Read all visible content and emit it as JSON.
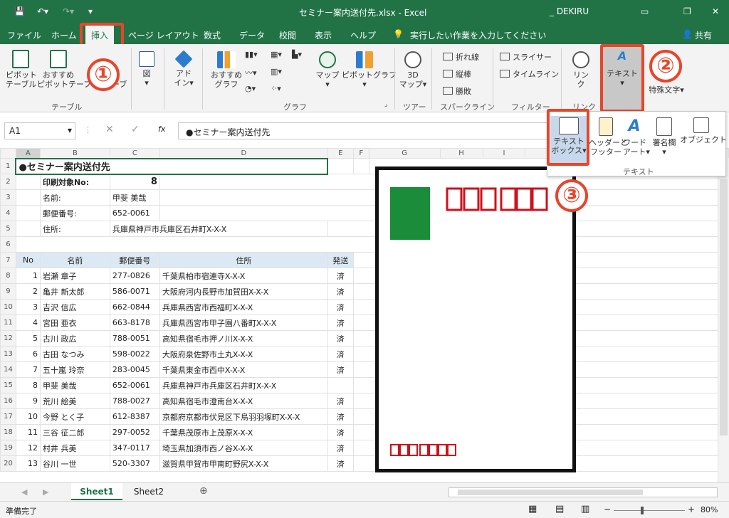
{
  "window": {
    "title": "セミナー案内送付先.xlsx  -  Excel",
    "user": "_ DEKIRU"
  },
  "tabs": [
    "ファイル",
    "ホーム",
    "挿入",
    "ページ レイアウト",
    "数式",
    "データ",
    "校閲",
    "表示",
    "ヘルプ"
  ],
  "tell_me": "実行したい作業を入力してください",
  "share": "共有",
  "ribbon": {
    "pivot1": "ピボット",
    "pivot2": "テーブル",
    "rec_pivot1": "おすすめ",
    "rec_pivot2": "ピボットテーブル",
    "table_label": "テーブ",
    "group_table": "テーブル",
    "figure": "図",
    "addin1": "アド",
    "addin2": "イン",
    "rec_chart1": "おすすめ",
    "rec_chart2": "グラフ",
    "map": "マップ",
    "pivot_chart": "ピボットグラフ",
    "group_graph": "グラフ",
    "map3d1": "3D",
    "map3d2": "マップ",
    "group_tour": "ツアー",
    "spark_line": "折れ線",
    "spark_col": "縦棒",
    "spark_win": "勝敗",
    "group_spark": "スパークライン",
    "slicer": "スライサー",
    "timeline": "タイムライン",
    "group_filter": "フィルター",
    "link1": "リン",
    "link2": "ク",
    "group_link": "リンク",
    "text": "テキスト",
    "symbols": "特殊文字"
  },
  "dropdown": {
    "textbox1": "テキスト",
    "textbox2": "ボックス",
    "header1": "ヘッダーと",
    "header2": "フッター",
    "wordart1": "ワード",
    "wordart2": "アート",
    "sign": "署名欄",
    "object": "オブジェクト",
    "group": "テキスト"
  },
  "formula": {
    "namebox": "A1",
    "fx": "fx",
    "value": "●セミナー案内送付先"
  },
  "columns": [
    "A",
    "B",
    "C",
    "D",
    "E",
    "F",
    "G",
    "H",
    "I"
  ],
  "sheet": {
    "title": "●セミナー案内送付先",
    "print_label": "印刷対象No:",
    "print_value": "8",
    "name_label": "名前:",
    "name_value": "甲斐 美哉",
    "zip_label": "郵便番号:",
    "zip_value": "652-0061",
    "addr_label": "住所:",
    "addr_value": "兵庫県神戸市兵庫区石井町X-X-X",
    "headers": [
      "No",
      "名前",
      "郵便番号",
      "住所",
      "発送"
    ]
  },
  "rows": [
    [
      "1",
      "岩瀬 章子",
      "277-0826",
      "千葉県柏市宿連寺X-X-X",
      "済"
    ],
    [
      "2",
      "亀井 新太郎",
      "586-0071",
      "大阪府河内長野市加賀田X-X-X",
      "済"
    ],
    [
      "3",
      "吉沢 信広",
      "662-0844",
      "兵庫県西宮市西福町X-X-X",
      "済"
    ],
    [
      "4",
      "宮田 亜衣",
      "663-8178",
      "兵庫県西宮市甲子園八番町X-X-X",
      "済"
    ],
    [
      "5",
      "古川 政広",
      "788-0051",
      "高知県宿毛市押ノ川X-X-X",
      "済"
    ],
    [
      "6",
      "古田 なつみ",
      "598-0022",
      "大阪府泉佐野市土丸X-X-X",
      "済"
    ],
    [
      "7",
      "五十嵐 玲奈",
      "283-0045",
      "千葉県東金市西中X-X-X",
      "済"
    ],
    [
      "8",
      "甲斐 美哉",
      "652-0061",
      "兵庫県神戸市兵庫区石井町X-X-X",
      ""
    ],
    [
      "9",
      "荒川 絵美",
      "788-0027",
      "高知県宿毛市澄南台X-X-X",
      "済"
    ],
    [
      "10",
      "今野 とく子",
      "612-8387",
      "京都府京都市伏見区下鳥羽羽塚町X-X-X",
      "済"
    ],
    [
      "11",
      "三谷 征二郎",
      "297-0052",
      "千葉県茂原市上茂原X-X-X",
      "済"
    ],
    [
      "12",
      "村井 兵美",
      "347-0117",
      "埼玉県加須市西ノ谷X-X-X",
      "済"
    ],
    [
      "13",
      "谷川 一世",
      "520-3307",
      "滋賀県甲賀市甲南町野尻X-X-X",
      "済"
    ]
  ],
  "row_numbers": [
    "1",
    "2",
    "3",
    "4",
    "5",
    "6",
    "7",
    "8",
    "9",
    "10",
    "11",
    "12",
    "13",
    "14",
    "15",
    "16",
    "17",
    "18",
    "19",
    "20"
  ],
  "sheets": [
    "Sheet1",
    "Sheet2"
  ],
  "status": {
    "ready": "準備完了",
    "zoom": "80%"
  },
  "badges": [
    "①",
    "②",
    "③"
  ],
  "colors": {
    "excel_green": "#217346",
    "highlight": "#e8452a",
    "stamp": "#1a8c3a",
    "postal_red": "#d0101a"
  }
}
